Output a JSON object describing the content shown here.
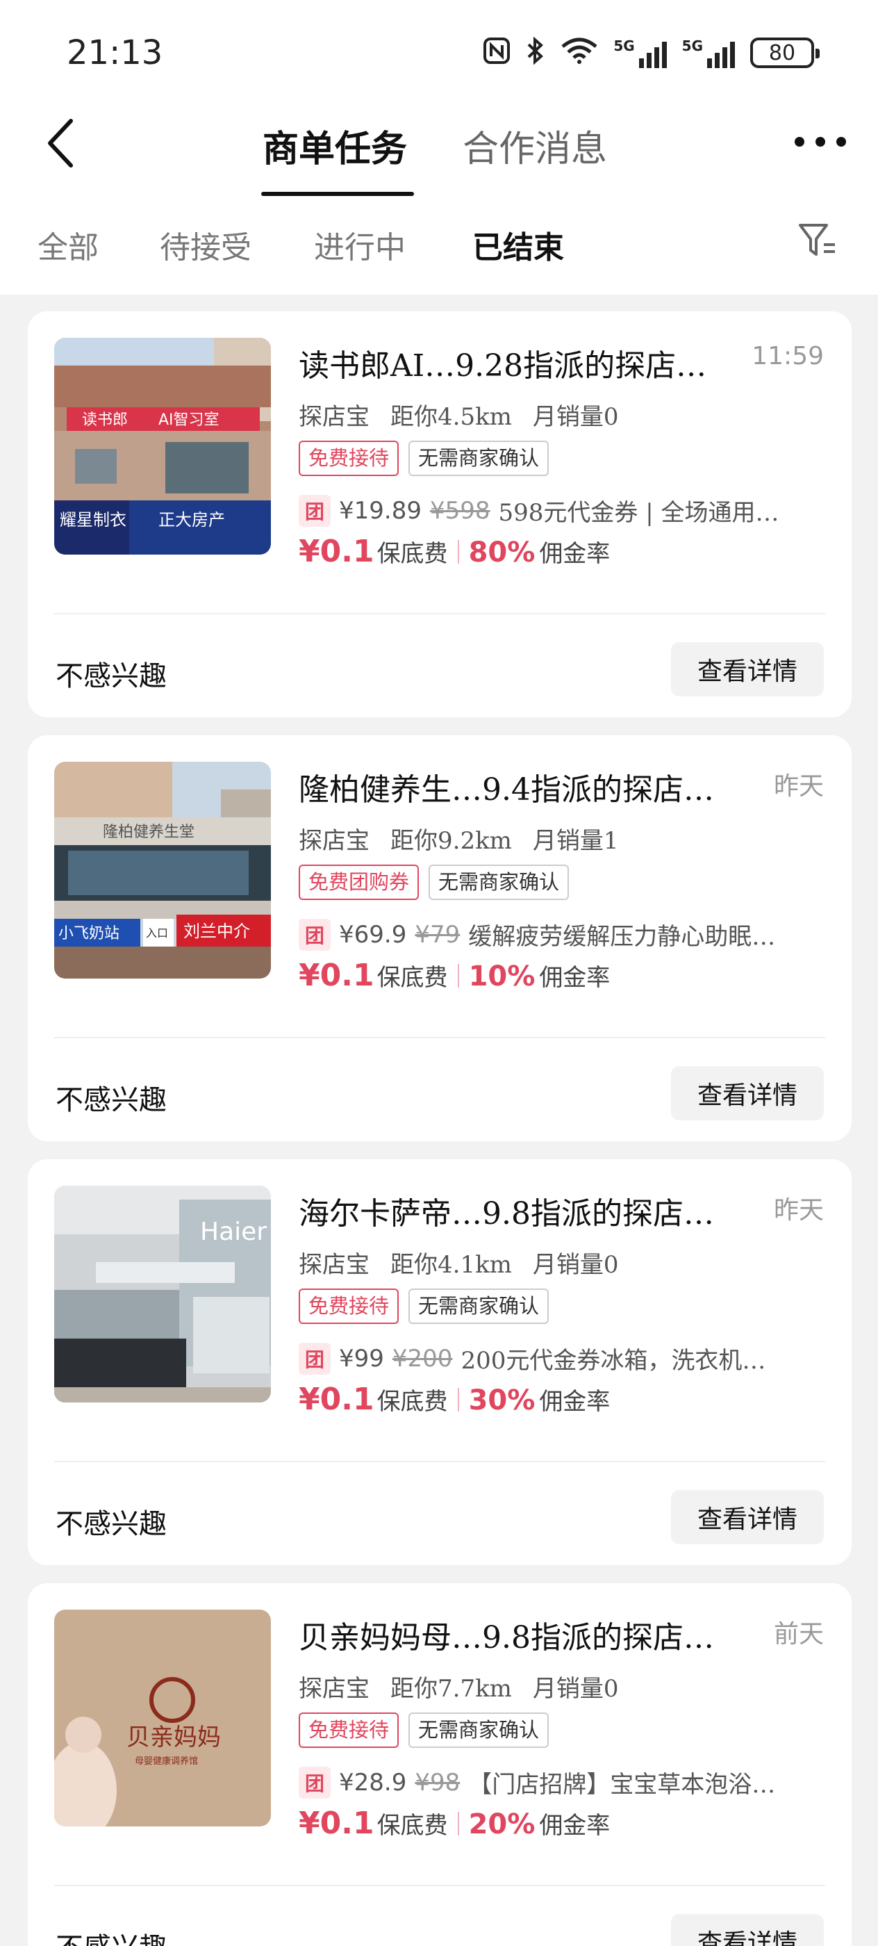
{
  "status_bar": {
    "time": "21:13",
    "nfc_icon": "nfc-icon",
    "bluetooth_icon": "bluetooth-icon",
    "wifi_icon": "wifi-icon",
    "signal_1_label": "5G",
    "signal_2_label": "5G",
    "battery": "80"
  },
  "header": {
    "tabs": [
      {
        "label": "商单任务",
        "active": true
      },
      {
        "label": "合作消息",
        "active": false
      }
    ]
  },
  "filter_tabs": [
    {
      "label": "全部",
      "active": false
    },
    {
      "label": "待接受",
      "active": false
    },
    {
      "label": "进行中",
      "active": false
    },
    {
      "label": "已结束",
      "active": true
    }
  ],
  "colors": {
    "accent_red": "#e0465d",
    "card_bg": "#ffffff",
    "page_bg": "#f2f2f2"
  },
  "cards": [
    {
      "title": "读书郎AI…9.28指派的探店…",
      "time": "11:59",
      "meta": {
        "source": "探店宝",
        "distance": "距你4.5km",
        "sales": "月销量0"
      },
      "tags": [
        "免费接待",
        "无需商家确认"
      ],
      "deal": {
        "badge": "团",
        "price": "¥19.89",
        "original": "¥598",
        "desc": "598元代金券 | 全场通用…"
      },
      "fee": {
        "value": "¥0.1",
        "label": "保底费",
        "rate": "80%",
        "rate_label": "佣金率"
      },
      "actions": {
        "ignore": "不感兴趣",
        "detail": "查看详情"
      },
      "thumb_signs": [
        "读书郎",
        "AI智习室",
        "耀星制衣",
        "正大房产"
      ]
    },
    {
      "title": "隆柏健养生…9.4指派的探店…",
      "time": "昨天",
      "meta": {
        "source": "探店宝",
        "distance": "距你9.2km",
        "sales": "月销量1"
      },
      "tags": [
        "免费团购券",
        "无需商家确认"
      ],
      "deal": {
        "badge": "团",
        "price": "¥69.9",
        "original": "¥79",
        "desc": "缓解疲劳缓解压力静心助眠…"
      },
      "fee": {
        "value": "¥0.1",
        "label": "保底费",
        "rate": "10%",
        "rate_label": "佣金率"
      },
      "actions": {
        "ignore": "不感兴趣",
        "detail": "查看详情"
      },
      "thumb_signs": [
        "隆柏健养生堂",
        "小飞奶站",
        "入口",
        "刘兰中介"
      ]
    },
    {
      "title": "海尔卡萨帝…9.8指派的探店…",
      "time": "昨天",
      "meta": {
        "source": "探店宝",
        "distance": "距你4.1km",
        "sales": "月销量0"
      },
      "tags": [
        "免费接待",
        "无需商家确认"
      ],
      "deal": {
        "badge": "团",
        "price": "¥99",
        "original": "¥200",
        "desc": "200元代金券冰箱，洗衣机…"
      },
      "fee": {
        "value": "¥0.1",
        "label": "保底费",
        "rate": "30%",
        "rate_label": "佣金率"
      },
      "actions": {
        "ignore": "不感兴趣",
        "detail": "查看详情"
      },
      "thumb_signs": [
        "Haier"
      ]
    },
    {
      "title": "贝亲妈妈母…9.8指派的探店…",
      "time": "前天",
      "meta": {
        "source": "探店宝",
        "distance": "距你7.7km",
        "sales": "月销量0"
      },
      "tags": [
        "免费接待",
        "无需商家确认"
      ],
      "deal": {
        "badge": "团",
        "price": "¥28.9",
        "original": "¥98",
        "desc": "【门店招牌】宝宝草本泡浴…"
      },
      "fee": {
        "value": "¥0.1",
        "label": "保底费",
        "rate": "20%",
        "rate_label": "佣金率"
      },
      "actions": {
        "ignore": "不感兴趣",
        "detail": "查看详情"
      },
      "thumb_signs": [
        "贝亲妈妈",
        "母婴健康调养馆"
      ]
    }
  ]
}
